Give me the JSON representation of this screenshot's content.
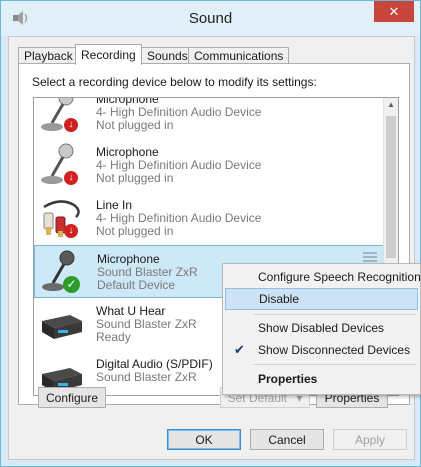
{
  "window": {
    "title": "Sound",
    "close_glyph": "✕"
  },
  "tabs": [
    "Playback",
    "Recording",
    "Sounds",
    "Communications"
  ],
  "instruction": "Select a recording device below to modify its settings:",
  "devices": [
    {
      "name": "Microphone",
      "desc": "4- High Definition Audio Device",
      "status": "Not plugged in",
      "icon": "microphone-icon",
      "state": "unplugged"
    },
    {
      "name": "Microphone",
      "desc": "4- High Definition Audio Device",
      "status": "Not plugged in",
      "icon": "microphone-icon",
      "state": "unplugged"
    },
    {
      "name": "Line In",
      "desc": "4- High Definition Audio Device",
      "status": "Not plugged in",
      "icon": "line-in-cable-icon",
      "state": "unplugged"
    },
    {
      "name": "Microphone",
      "desc": "Sound Blaster ZxR",
      "status": "Default Device",
      "icon": "microphone-icon",
      "state": "default"
    },
    {
      "name": "What U Hear",
      "desc": "Sound Blaster ZxR",
      "status": "Ready",
      "icon": "soundcard-icon",
      "state": "ready"
    },
    {
      "name": "Digital Audio (S/PDIF)",
      "desc": "Sound Blaster ZxR",
      "status": "",
      "icon": "soundcard-icon",
      "state": "ready"
    }
  ],
  "buttons": {
    "configure": "Configure",
    "set_default": "Set Default",
    "properties": "Properties",
    "ok": "OK",
    "cancel": "Cancel",
    "apply": "Apply"
  },
  "context_menu": {
    "items": [
      {
        "label": "Configure Speech Recognition"
      },
      {
        "label": "Disable",
        "highlighted": true
      },
      {
        "label": "Show Disabled Devices"
      },
      {
        "label": "Show Disconnected Devices",
        "checked": true
      },
      {
        "label": "Properties",
        "bold": true
      }
    ]
  },
  "colors": {
    "selection": "#cde8f7",
    "title_bar": "#e1eff8",
    "close_button": "#c7453a",
    "status_error": "#d02020",
    "status_ok": "#2a9d2a"
  }
}
